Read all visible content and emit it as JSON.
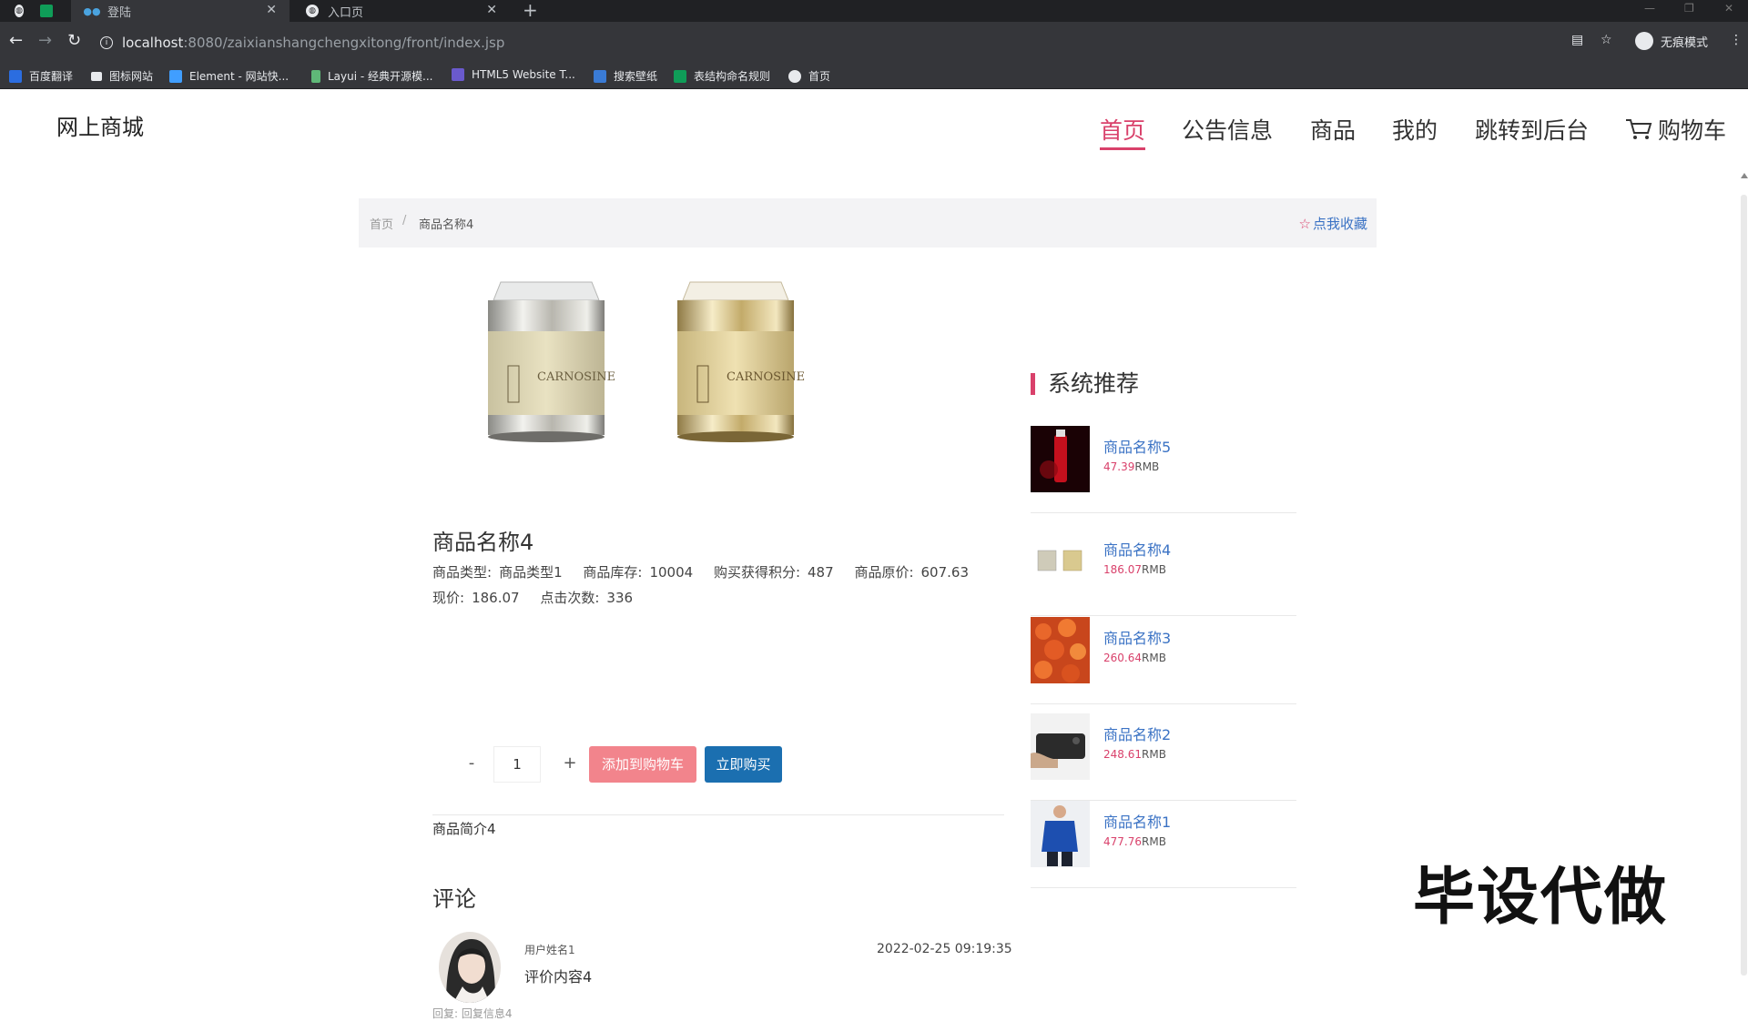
{
  "browser": {
    "tabs": [
      {
        "label": ""
      },
      {
        "label": ""
      },
      {
        "label": "登陆"
      },
      {
        "label": "入口页"
      }
    ],
    "url_host": "localhost",
    "url_path": ":8080/zaixianshangchengxitong/front/index.jsp",
    "incognito_label": "无痕模式",
    "bookmarks": [
      "百度翻译",
      "图标网站",
      "Element - 网站快...",
      "Layui - 经典开源模...",
      "HTML5 Website T...",
      "搜索壁纸",
      "表结构命名规则",
      "首页"
    ]
  },
  "site": {
    "logo": "网上商城",
    "nav": [
      "首页",
      "公告信息",
      "商品",
      "我的",
      "跳转到后台",
      "购物车"
    ]
  },
  "breadcrumb": {
    "home": "首页",
    "separator": "/",
    "current": "商品名称4",
    "favorite_label": "点我收藏"
  },
  "product": {
    "name": "商品名称4",
    "row1": [
      {
        "label": "商品类型:",
        "value": "商品类型1"
      },
      {
        "label": "商品库存:",
        "value": "10004"
      },
      {
        "label": "购买获得积分:",
        "value": "487"
      },
      {
        "label": "商品原价:",
        "value": "607.63"
      }
    ],
    "row2": [
      {
        "label": "现价:",
        "value": "186.07"
      },
      {
        "label": "点击次数:",
        "value": "336"
      }
    ],
    "quantity": "1",
    "minus": "-",
    "plus": "+",
    "add_to_cart": "添加到购物车",
    "buy_now": "立即购买",
    "description": "商品简介4",
    "image_text": "CARNOSINE"
  },
  "comments": {
    "title": "评论",
    "items": [
      {
        "user": "用户姓名1",
        "text": "评价内容4",
        "time": "2022-02-25 09:19:35",
        "reply": "回复: 回复信息4"
      }
    ]
  },
  "recommend": {
    "title": "系统推荐",
    "currency": "RMB",
    "items": [
      {
        "name": "商品名称5",
        "price": "47.39"
      },
      {
        "name": "商品名称4",
        "price": "186.07"
      },
      {
        "name": "商品名称3",
        "price": "260.64"
      },
      {
        "name": "商品名称2",
        "price": "248.61"
      },
      {
        "name": "商品名称1",
        "price": "477.76"
      }
    ]
  },
  "watermark": "毕设代做",
  "colors": {
    "accent": "#d9416b",
    "link": "#3a72c4",
    "cart_button": "#f2848c",
    "buy_button": "#1b6fb0"
  }
}
